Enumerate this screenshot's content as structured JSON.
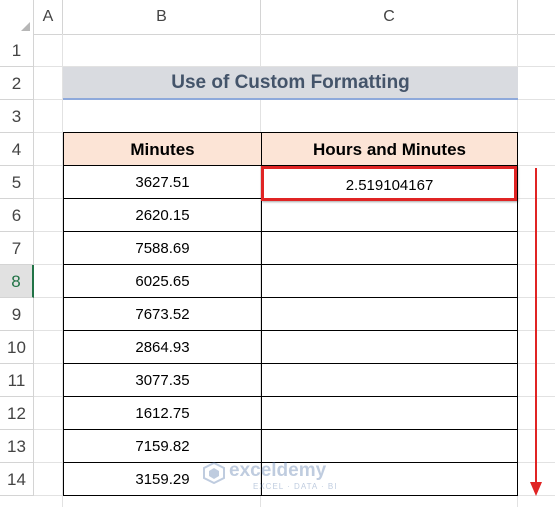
{
  "sheet": {
    "columns": [
      "A",
      "B",
      "C"
    ],
    "rows": [
      "1",
      "2",
      "3",
      "4",
      "5",
      "6",
      "7",
      "8",
      "9",
      "10",
      "11",
      "12",
      "13",
      "14"
    ],
    "active_row": "8"
  },
  "title": "Use of Custom Formatting",
  "table": {
    "headers": [
      "Minutes",
      "Hours and Minutes"
    ],
    "minutes": [
      "3627.51",
      "2620.15",
      "7588.69",
      "6025.65",
      "7673.52",
      "2864.93",
      "3077.35",
      "1612.75",
      "7159.82",
      "3159.29"
    ],
    "result_first": "2.519104167"
  },
  "watermark": {
    "name": "exceldemy",
    "tagline": "EXCEL · DATA · BI"
  },
  "colors": {
    "header_fill": "#fce4d6",
    "title_fill": "#d9dbe0",
    "highlight": "#e02424",
    "active_header": "#217346"
  }
}
